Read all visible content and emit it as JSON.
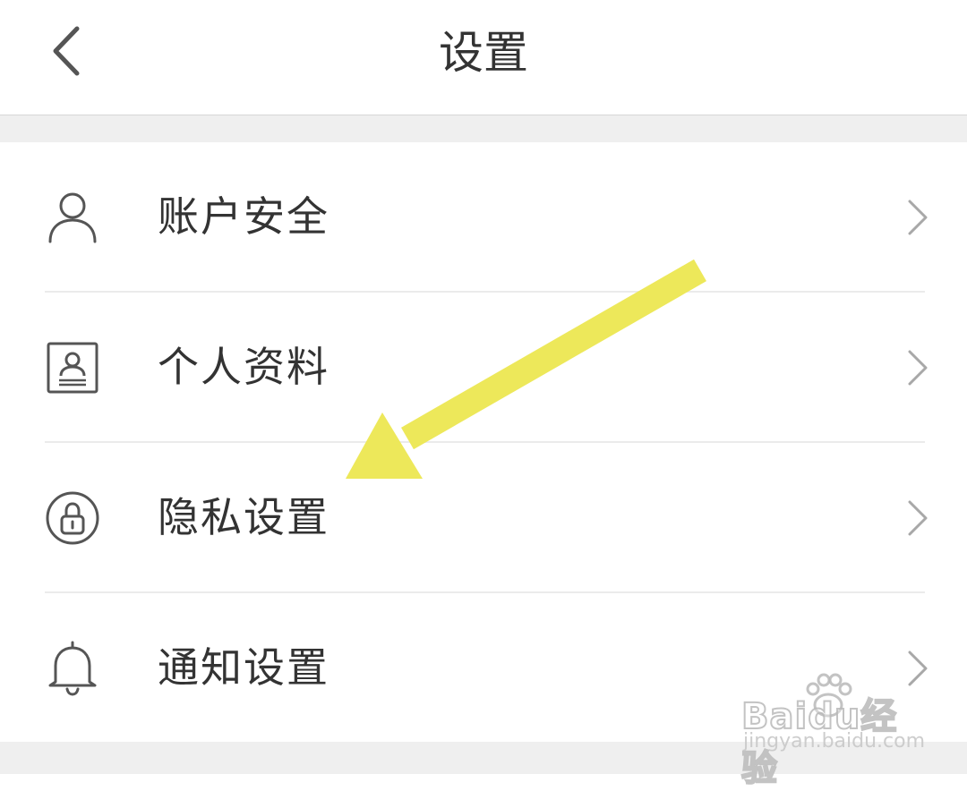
{
  "nav": {
    "title": "设置",
    "back_icon": "chevron-left-icon"
  },
  "menu": {
    "items": [
      {
        "label": "账户安全",
        "icon": "user-icon"
      },
      {
        "label": "个人资料",
        "icon": "profile-card-icon"
      },
      {
        "label": "隐私设置",
        "icon": "lock-icon"
      },
      {
        "label": "通知设置",
        "icon": "bell-icon"
      }
    ],
    "chevron_icon": "chevron-right-icon"
  },
  "annotation": {
    "type": "arrow",
    "color": "#EDE85A",
    "points_to": "隐私设置"
  },
  "watermark": {
    "brand": "Baidu经验",
    "url": "jingyan.baidu.com"
  },
  "colors": {
    "text": "#333333",
    "icon": "#555555",
    "chevron": "#a8a8a8",
    "background_gap": "#efefef",
    "divider": "#ebebeb"
  }
}
